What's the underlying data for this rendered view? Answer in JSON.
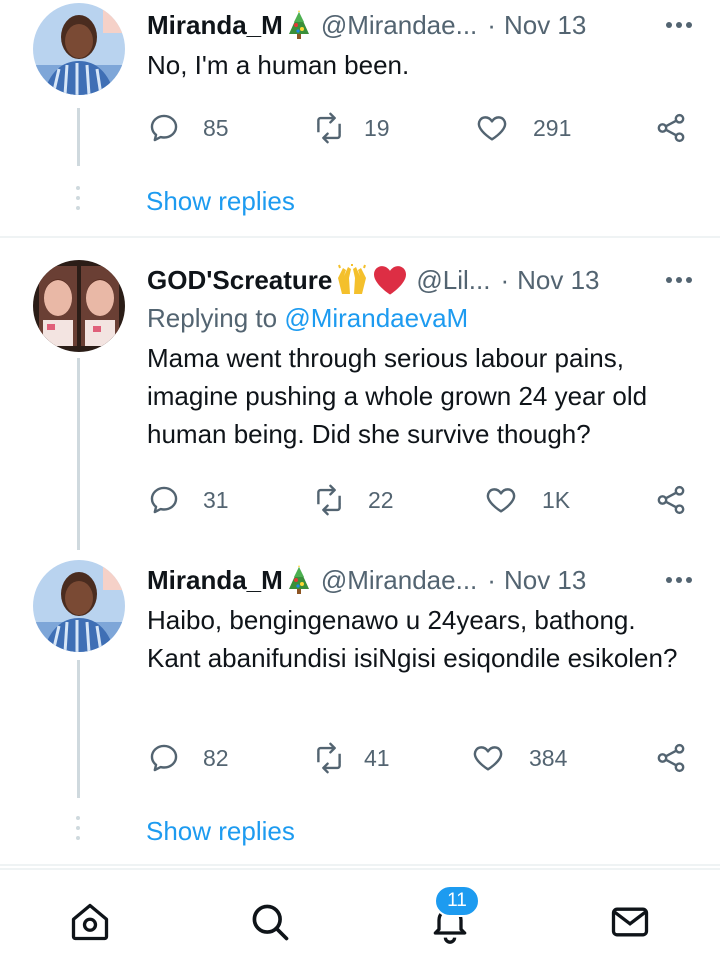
{
  "tweets": [
    {
      "name": "Miranda_M",
      "handle": "@Mirandae...",
      "date": "Nov 13",
      "text": "No, I'm a human been.",
      "replies": "85",
      "retweets": "19",
      "likes": "291"
    },
    {
      "name": "GOD'Screature",
      "handle": "@Lil...",
      "date": "Nov 13",
      "replying_prefix": "Replying to ",
      "replying_to": "@MirandaevaM",
      "text": "Mama went through serious labour pains, imagine pushing a whole grown 24 year old human being. Did she survive though?",
      "replies": "31",
      "retweets": "22",
      "likes": "1K"
    },
    {
      "name": "Miranda_M",
      "handle": "@Mirandae...",
      "date": "Nov 13",
      "text": "Haibo, bengingenawo u 24years, bathong. Kant abanifundisi isiNgisi esiqondile esikolen?",
      "replies": "82",
      "retweets": "41",
      "likes": "384"
    }
  ],
  "separator": "·",
  "show_replies_label": "Show replies",
  "nav": {
    "notifications_badge": "11",
    "items": [
      "home-icon",
      "search-icon",
      "notifications-icon",
      "messages-icon"
    ]
  },
  "colors": {
    "accent": "#1d9bf0",
    "text": "#0f1419",
    "muted": "#536471",
    "line": "#cfd9de"
  }
}
